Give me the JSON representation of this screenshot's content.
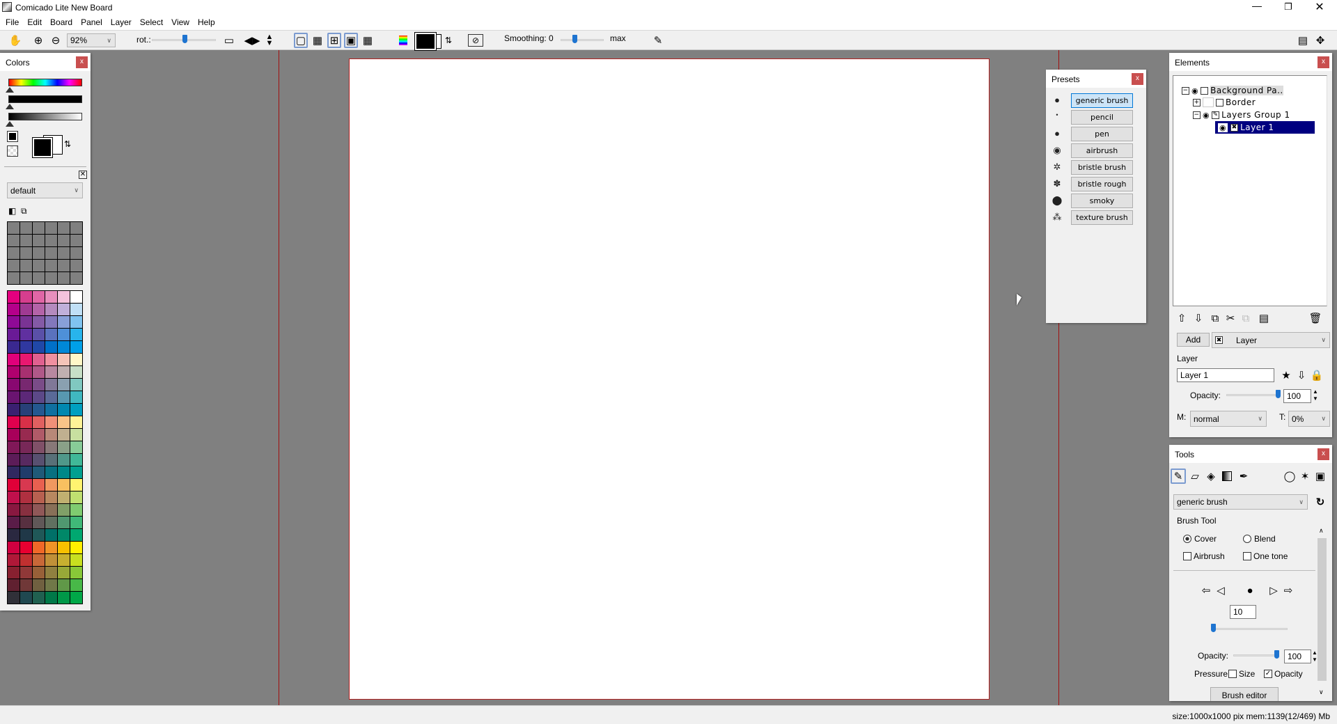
{
  "window": {
    "title": "Comicado Lite  New Board",
    "controls": [
      "minimize",
      "restore",
      "close"
    ]
  },
  "menu": [
    "File",
    "Edit",
    "Board",
    "Panel",
    "Layer",
    "Select",
    "View",
    "Help"
  ],
  "toolbar": {
    "zoom_value": "92%",
    "rot_label": "rot.:",
    "rotation_fraction": 0.5,
    "smoothing_label": "Smoothing: 0",
    "smoothing_max_label": "max",
    "smoothing_fraction": 0.45,
    "current_color": "#000000"
  },
  "colors_panel": {
    "title": "Colors",
    "palette_name": "default",
    "foreground": "#000000",
    "background": "#ffffff",
    "palette": [
      [
        "#e4007f",
        "#d63e8e",
        "#e066a6",
        "#e88fbd",
        "#f4c2dc",
        "#ffffff"
      ],
      [
        "#b4008a",
        "#a03a92",
        "#b463a8",
        "#b48abe",
        "#c0b0da",
        "#c0e0f6"
      ],
      [
        "#8e0a96",
        "#7a3394",
        "#845aa6",
        "#8278bc",
        "#88a0d8",
        "#80c4f0"
      ],
      [
        "#6a1a96",
        "#6030a0",
        "#5a50a8",
        "#5a72be",
        "#4e90d8",
        "#28b4ec"
      ],
      [
        "#3a2890",
        "#3038a0",
        "#2048a8",
        "#0070c8",
        "#0088d8",
        "#00a0e8"
      ],
      [
        "#e0007a",
        "#e81870",
        "#e06090",
        "#f090a0",
        "#f4c4b8",
        "#fff8c8"
      ],
      [
        "#b0006e",
        "#a83070",
        "#b05888",
        "#b888a0",
        "#c0b0b0",
        "#c8e0c8"
      ],
      [
        "#880870",
        "#782870",
        "#7a4c88",
        "#807898",
        "#8aa0b0",
        "#80c8c0"
      ],
      [
        "#6a1470",
        "#5c2878",
        "#5c4888",
        "#5a6a98",
        "#5898b0",
        "#40b8c0"
      ],
      [
        "#3a2070",
        "#284078",
        "#245890",
        "#1070a0",
        "#0088b0",
        "#00a0c0"
      ],
      [
        "#e0004e",
        "#d83048",
        "#e06060",
        "#f09078",
        "#f8c488",
        "#fff498"
      ],
      [
        "#a8005a",
        "#982a50",
        "#b05a68",
        "#b88878",
        "#c0b090",
        "#c8e0a0"
      ],
      [
        "#801858",
        "#782858",
        "#805068",
        "#887878",
        "#8aa088",
        "#88cc98"
      ],
      [
        "#5c1c58",
        "#582a60",
        "#585070",
        "#587078",
        "#50988a",
        "#40b898"
      ],
      [
        "#302860",
        "#203c6a",
        "#205a78",
        "#087080",
        "#008888",
        "#00a090"
      ],
      [
        "#e00038",
        "#d83850",
        "#e86050",
        "#f09860",
        "#f8c060",
        "#fff470"
      ],
      [
        "#c0104c",
        "#b03040",
        "#b86050",
        "#b88860",
        "#c0b070",
        "#c0e070"
      ],
      [
        "#881840",
        "#883040",
        "#905858",
        "#887058",
        "#80a068",
        "#80cc70"
      ],
      [
        "#5a1c48",
        "#583040",
        "#605858",
        "#607060",
        "#509870",
        "#40b878"
      ],
      [
        "#2a2840",
        "#203848",
        "#205858",
        "#007068",
        "#008868",
        "#00a870"
      ],
      [
        "#d00040",
        "#e80030",
        "#f06828",
        "#f09428",
        "#f8c000",
        "#fff000"
      ],
      [
        "#b01838",
        "#c03030",
        "#c86838",
        "#c09038",
        "#c8b030",
        "#c8e020"
      ],
      [
        "#882030",
        "#903838",
        "#986038",
        "#908040",
        "#98a838",
        "#88c838"
      ],
      [
        "#602030",
        "#703838",
        "#706040",
        "#707848",
        "#609848",
        "#48b848"
      ],
      [
        "#303038",
        "#204850",
        "#206050",
        "#007848",
        "#009848",
        "#00a848"
      ]
    ]
  },
  "presets_panel": {
    "title": "Presets",
    "items": [
      "generic brush",
      "pencil",
      "pen",
      "airbrush",
      "bristle brush",
      "bristle rough",
      "smoky",
      "texture brush"
    ],
    "selected": "generic brush"
  },
  "elements_panel": {
    "title": "Elements",
    "tree": [
      {
        "label": "Background Pa..",
        "level": 0
      },
      {
        "label": "Border",
        "level": 1
      },
      {
        "label": "Layers Group 1",
        "level": 1
      },
      {
        "label": "Layer 1",
        "level": 2,
        "selected": true
      }
    ],
    "add_label": "Add",
    "add_type": "Layer",
    "layer_section": "Layer",
    "layer_name": "Layer 1",
    "opacity_label": "Opacity:",
    "opacity": "100",
    "mode_label": "M:",
    "mode": "normal",
    "t_label": "T:",
    "t_value": "0%"
  },
  "tools_panel": {
    "title": "Tools",
    "preset": "generic brush",
    "section": "Brush Tool",
    "cover": "Cover",
    "blend": "Blend",
    "airbrush": "Airbrush",
    "one_tone": "One tone",
    "size": "10",
    "opacity_label": "Opacity:",
    "opacity": "100",
    "pressure_label": "Pressure:",
    "pressure_size": "Size",
    "pressure_opacity": "Opacity",
    "brush_editor": "Brush editor",
    "mode_selected": "Cover",
    "pressure_opacity_checked": true
  },
  "status": "size:1000x1000 pix  mem:1139(12/469) Mb",
  "accent": "#1e74d0",
  "selection_color": "#000080",
  "close_color": "#c94f4f"
}
